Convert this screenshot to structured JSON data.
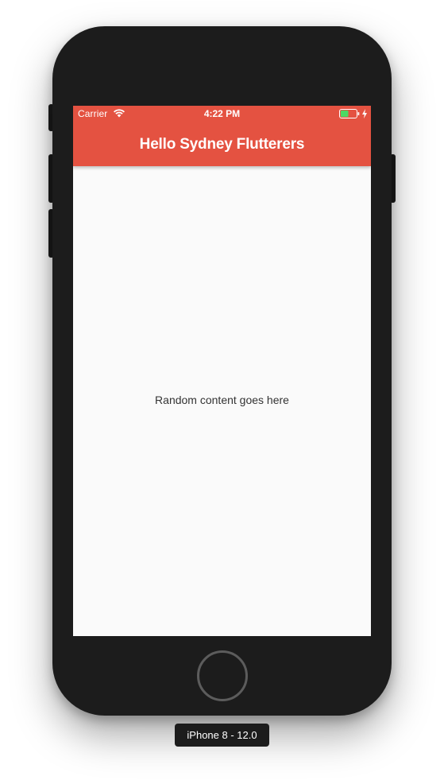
{
  "status_bar": {
    "carrier": "Carrier",
    "time": "4:22 PM",
    "battery_level": 0.5,
    "battery_color": "#4cd964",
    "charging": true
  },
  "app_bar": {
    "title": "Hello Sydney Flutterers",
    "color": "#e45241"
  },
  "body": {
    "text": "Random content goes here",
    "background": "#fafafa"
  },
  "simulator": {
    "device_label": "iPhone 8 - 12.0"
  },
  "icons": {
    "wifi": "wifi-icon",
    "battery": "battery-icon",
    "charging": "bolt-icon",
    "home": "home-button"
  }
}
